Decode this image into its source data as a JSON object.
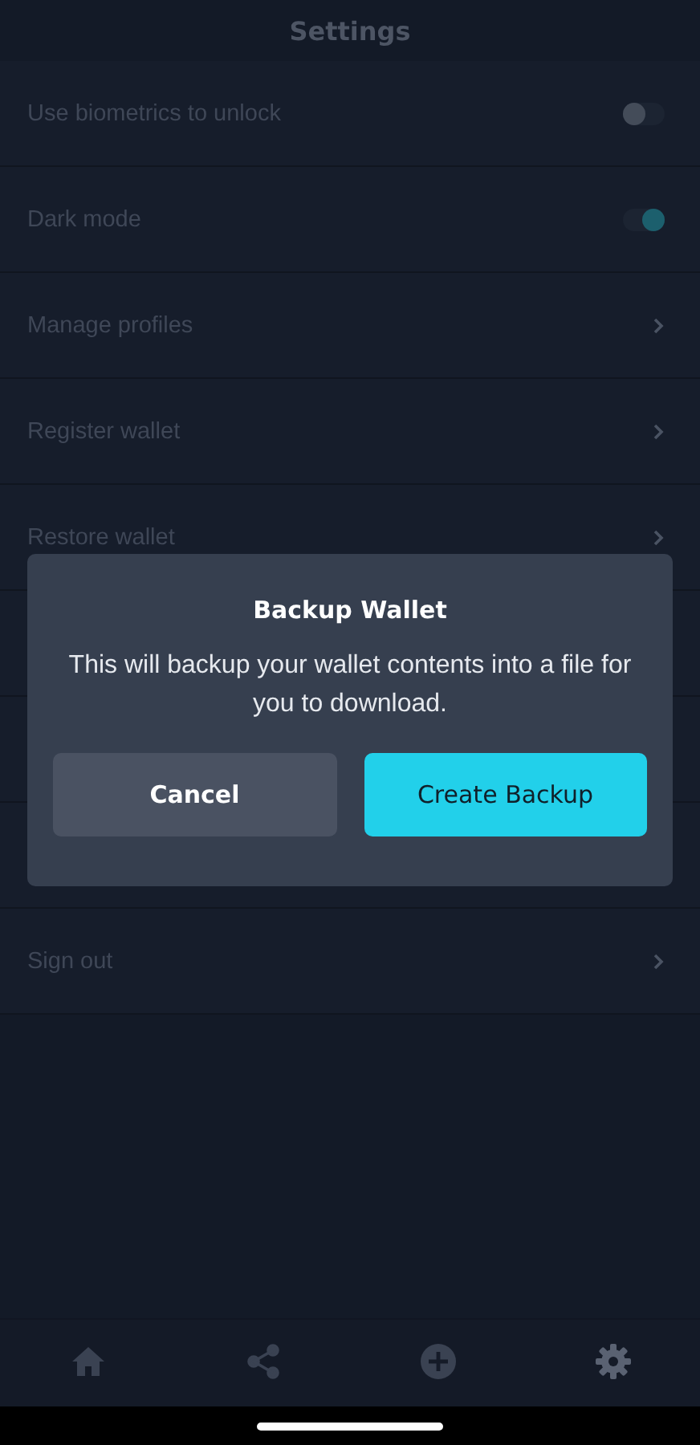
{
  "header": {
    "title": "Settings"
  },
  "settings": [
    {
      "kind": "toggle",
      "label": "Use biometrics to unlock",
      "on": false
    },
    {
      "kind": "toggle",
      "label": "Dark mode",
      "on": true
    },
    {
      "kind": "link",
      "label": "Manage profiles"
    },
    {
      "kind": "link",
      "label": "Register wallet"
    },
    {
      "kind": "link",
      "label": "Restore wallet"
    },
    {
      "kind": "hidden"
    },
    {
      "kind": "hidden"
    },
    {
      "kind": "hidden"
    },
    {
      "kind": "link",
      "label": "Sign out"
    }
  ],
  "dialog": {
    "title": "Backup Wallet",
    "message": "This will backup your wallet contents into a file for you to download.",
    "buttons": [
      {
        "label": "Cancel",
        "primary": false
      },
      {
        "label": "Create Backup",
        "primary": true
      }
    ]
  },
  "nav": [
    {
      "kind": "home",
      "selected": false
    },
    {
      "kind": "share",
      "selected": false
    },
    {
      "kind": "add",
      "selected": false
    },
    {
      "kind": "settings",
      "selected": true
    }
  ]
}
